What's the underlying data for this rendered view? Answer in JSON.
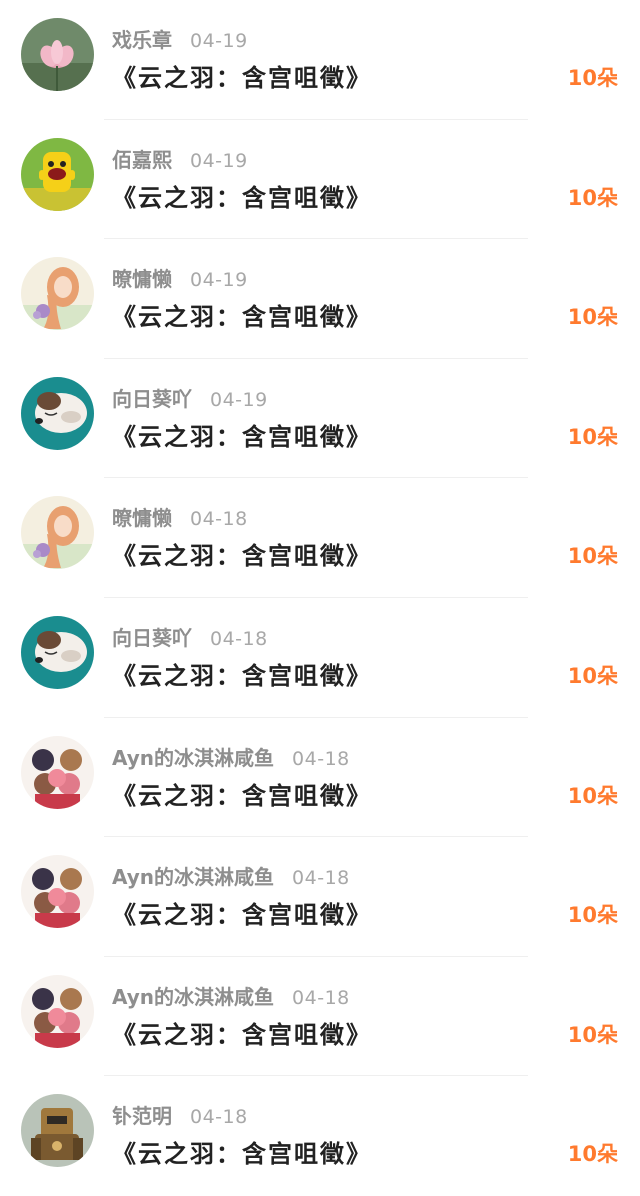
{
  "gift_list": [
    {
      "user": "戏乐章",
      "date": "04-19",
      "title": "《云之羽：含宫咀徵》",
      "amount": "10朵",
      "avatar_icon": "lotus-avatar-icon"
    },
    {
      "user": "佰嘉熙",
      "date": "04-19",
      "title": "《云之羽：含宫咀徵》",
      "amount": "10朵",
      "avatar_icon": "yellow-monster-avatar-icon"
    },
    {
      "user": "暸慵懒",
      "date": "04-19",
      "title": "《云之羽：含宫咀徵》",
      "amount": "10朵",
      "avatar_icon": "anime-girl-avatar-icon"
    },
    {
      "user": "向日葵吖",
      "date": "04-19",
      "title": "《云之羽：含宫咀徵》",
      "amount": "10朵",
      "avatar_icon": "sleeping-dog-avatar-icon"
    },
    {
      "user": "暸慵懒",
      "date": "04-18",
      "title": "《云之羽：含宫咀徵》",
      "amount": "10朵",
      "avatar_icon": "anime-girl-avatar-icon"
    },
    {
      "user": "向日葵吖",
      "date": "04-18",
      "title": "《云之羽：含宫咀徵》",
      "amount": "10朵",
      "avatar_icon": "sleeping-dog-avatar-icon"
    },
    {
      "user": "Ayn的冰淇淋咸鱼",
      "date": "04-18",
      "title": "《云之羽：含宫咀徵》",
      "amount": "10朵",
      "avatar_icon": "anime-group-avatar-icon"
    },
    {
      "user": "Ayn的冰淇淋咸鱼",
      "date": "04-18",
      "title": "《云之羽：含宫咀徵》",
      "amount": "10朵",
      "avatar_icon": "anime-group-avatar-icon"
    },
    {
      "user": "Ayn的冰淇淋咸鱼",
      "date": "04-18",
      "title": "《云之羽：含宫咀徵》",
      "amount": "10朵",
      "avatar_icon": "anime-group-avatar-icon"
    },
    {
      "user": "钋范明",
      "date": "04-18",
      "title": "《云之羽：含宫咀徵》",
      "amount": "10朵",
      "avatar_icon": "robot-avatar-icon"
    }
  ],
  "colors": {
    "amount": "#ff7a2e",
    "title": "#222222",
    "username": "#8e8e8e",
    "date": "#a8a8a8",
    "divider": "#efefef"
  }
}
